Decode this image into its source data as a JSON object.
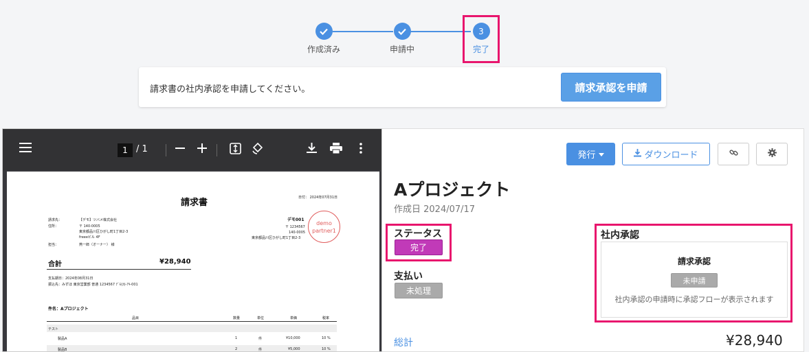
{
  "stepper": {
    "steps": [
      {
        "label": "作成済み",
        "icon": "check-icon"
      },
      {
        "label": "申請中",
        "icon": "check-icon"
      },
      {
        "label": "完了",
        "number": "3"
      }
    ]
  },
  "request": {
    "message": "請求書の社内承認を申請してください。",
    "button_label": "請求承認を申請"
  },
  "pdf_viewer": {
    "page_current": "1",
    "page_total": "/ 1",
    "document": {
      "title": "請求書",
      "date": "日付： 2024年07月31日",
      "bill_to_label": "請求先：",
      "bill_to_value": "【デモ】ツバメ株式会社",
      "address_label": "住所：",
      "address_lines": [
        "〒 140-0005",
        "東京都品川区ひがし町1丁目2-3",
        "freeeビル 4F"
      ],
      "contact_label": "担当：",
      "contact_value": "燕一郎（オーナー） 様",
      "issuer_name": "デモ001",
      "issuer_lines": [
        "〒 1234567",
        "140-0005",
        "東京都品川区ひがし町1丁目2-3"
      ],
      "stamp_lines": [
        "demo",
        "partner1"
      ],
      "total_label": "合計",
      "total_value": "¥28,940",
      "due_date": "支払期日：2024年08月31日",
      "bank_info": "振込先：みずほ 東京営業部 普通 1234567 ﾃﾞﾓ(ｶ)-ｱｷ-001",
      "project_line": "件名：Aプロジェクト",
      "table_headers": [
        "品目",
        "数量",
        "単位",
        "単価",
        "税率"
      ],
      "rows": [
        {
          "item": "テスト",
          "qty": "",
          "unit": "",
          "price": "",
          "tax": ""
        },
        {
          "item": "製品A",
          "qty": "1",
          "unit": "件",
          "price": "¥10,000",
          "tax": "10 %"
        },
        {
          "item": "製品B",
          "qty": "2",
          "unit": "件",
          "price": "¥5,000",
          "tax": "10 %"
        }
      ]
    }
  },
  "panel": {
    "issue_button": "発行",
    "download_button": "ダウンロード",
    "project_title": "Aプロジェクト",
    "created_date": "作成日 2024/07/17",
    "status_label": "ステータス",
    "status_value": "完了",
    "payment_label": "支払い",
    "payment_value": "未処理",
    "approval_title": "社内承認",
    "approval_box_title": "請求承認",
    "approval_badge": "未申請",
    "approval_desc": "社内承認の申請時に承認フローが表示されます",
    "total_label": "総計",
    "total_value": "¥28,940"
  },
  "colors": {
    "accent": "#4a90e2",
    "highlight": "#e8156d",
    "status_complete": "#c13ab8",
    "neutral_badge": "#aaaaaa"
  }
}
